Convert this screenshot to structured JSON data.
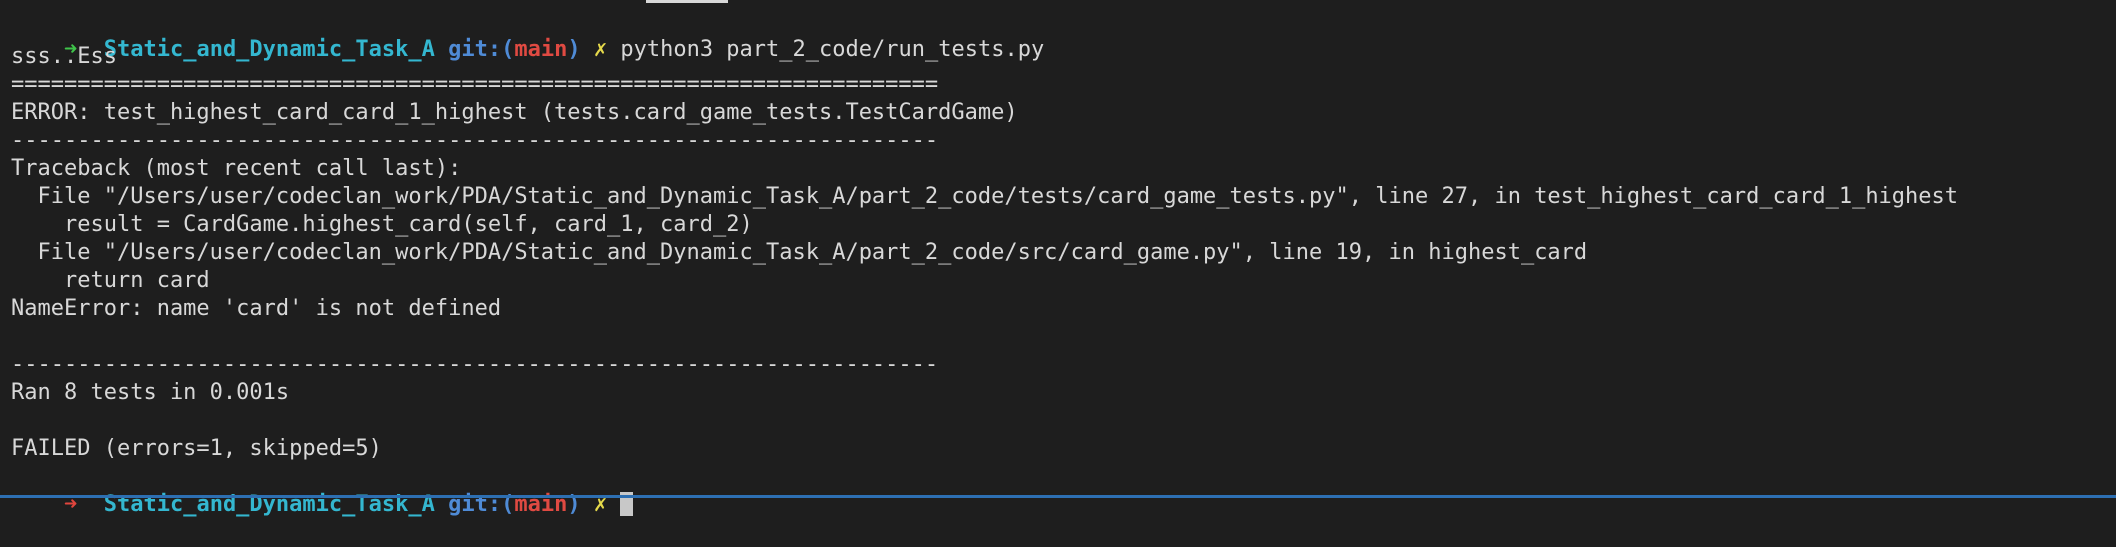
{
  "prompt": {
    "arrow": "➜",
    "directory": "Static_and_Dynamic_Task_A",
    "git_label": "git:(",
    "branch": "main",
    "git_close": ")",
    "dirty_mark": "✗"
  },
  "command": "python3 part_2_code/run_tests.py",
  "output": [
    "sss..Ess",
    "======================================================================",
    "ERROR: test_highest_card_card_1_highest (tests.card_game_tests.TestCardGame)",
    "----------------------------------------------------------------------",
    "Traceback (most recent call last):",
    "  File \"/Users/user/codeclan_work/PDA/Static_and_Dynamic_Task_A/part_2_code/tests/card_game_tests.py\", line 27, in test_highest_card_card_1_highest",
    "    result = CardGame.highest_card(self, card_1, card_2)",
    "  File \"/Users/user/codeclan_work/PDA/Static_and_Dynamic_Task_A/part_2_code/src/card_game.py\", line 19, in highest_card",
    "    return card",
    "NameError: name 'card' is not defined",
    "",
    "----------------------------------------------------------------------",
    "Ran 8 tests in 0.001s",
    "",
    "FAILED (errors=1, skipped=5)"
  ]
}
